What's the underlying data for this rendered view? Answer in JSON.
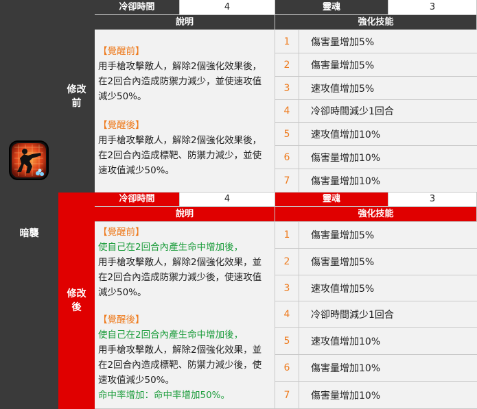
{
  "skill": {
    "name": "暗襲",
    "icon": "gunner-silhouette-icon"
  },
  "before": {
    "label": "修改前",
    "cooldown_label": "冷卻時間",
    "cooldown_value": "4",
    "soul_label": "靈魂",
    "soul_value": "3",
    "desc_header": "說明",
    "enh_header": "強化技能",
    "desc": {
      "pre_label": "【覺醒前】",
      "pre_text": "用手槍攻擊敵人，解除2個強化效果後，在2回合內造成防禦力減少，並使速攻值減少50%。",
      "post_label": "【覺醒後】",
      "post_text": "用手槍攻擊敵人，解除2個強化效果後，在2回合內造成標靶、防禦力減少，並使速攻值減少50%。"
    },
    "enhancements": [
      {
        "num": "1",
        "text": "傷害量增加5%"
      },
      {
        "num": "2",
        "text": "傷害量增加5%"
      },
      {
        "num": "3",
        "text": "速攻值增加5%"
      },
      {
        "num": "4",
        "text": "冷卻時間減少1回合"
      },
      {
        "num": "5",
        "text": "速攻值增加10%"
      },
      {
        "num": "6",
        "text": "傷害量增加10%"
      },
      {
        "num": "7",
        "text": "傷害量增加10%"
      }
    ]
  },
  "after": {
    "label": "修改後",
    "cooldown_label": "冷卻時間",
    "cooldown_value": "4",
    "soul_label": "靈魂",
    "soul_value": "3",
    "desc_header": "說明",
    "enh_header": "強化技能",
    "desc": {
      "pre_label": "【覺醒前】",
      "pre_green": "使自己在2回合內產生命中增加後，",
      "pre_text": "用手槍攻擊敵人，解除2個強化效果，並在2回合內造成防禦力減少後，使速攻值減少50%。",
      "post_label": "【覺醒後】",
      "post_green": "使自己在2回合內產生命中增加後，",
      "post_text": "用手槍攻擊敵人，解除2個強化效果，並在2回合內造成標靶、防禦力減少後，使速攻值減少50%。",
      "footer_green": "命中率增加：命中率增加50%。"
    },
    "enhancements": [
      {
        "num": "1",
        "text": "傷害量增加5%"
      },
      {
        "num": "2",
        "text": "傷害量增加5%"
      },
      {
        "num": "3",
        "text": "速攻值增加5%"
      },
      {
        "num": "4",
        "text": "冷卻時間減少1回合"
      },
      {
        "num": "5",
        "text": "速攻值增加10%"
      },
      {
        "num": "6",
        "text": "傷害量增加10%"
      },
      {
        "num": "7",
        "text": "傷害量增加10%"
      }
    ]
  },
  "colors": {
    "dark": "#3a3a3a",
    "red": "#e00000",
    "orange": "#ee7a1c",
    "green": "#1a9c3a"
  }
}
